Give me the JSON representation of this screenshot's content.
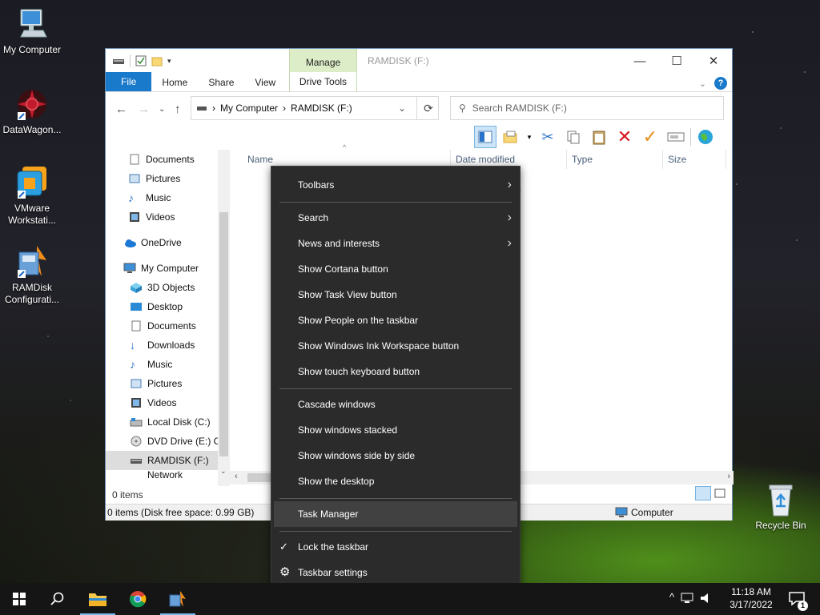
{
  "desktop": {
    "icons": [
      {
        "label": "My Computer",
        "icon": "computer-icon"
      },
      {
        "label": "DataWagon...",
        "icon": "datawagon-icon"
      },
      {
        "label": "VMware Workstati...",
        "icon": "vmware-icon"
      },
      {
        "label": "RAMDisk Configurati...",
        "icon": "ramdisk-icon"
      },
      {
        "label": "Recycle Bin",
        "icon": "recycle-bin-icon"
      }
    ]
  },
  "window": {
    "title": "RAMDISK (F:)",
    "context_group": "Manage",
    "tabs": {
      "file": "File",
      "home": "Home",
      "share": "Share",
      "view": "View",
      "drive_tools": "Drive Tools"
    },
    "address": {
      "crumbs": [
        "My Computer",
        "RAMDISK (F:)"
      ],
      "separator": "›"
    },
    "search_placeholder": "Search RAMDISK (F:)",
    "nav": {
      "quick": [
        "Documents",
        "Pictures",
        "Music",
        "Videos"
      ],
      "onedrive": "OneDrive",
      "pc": "My Computer",
      "pc_items": [
        "3D Objects",
        "Desktop",
        "Documents",
        "Downloads",
        "Music",
        "Pictures",
        "Videos",
        "Local Disk (C:)",
        "DVD Drive (E:) CI",
        "RAMDISK (F:)",
        "Network"
      ]
    },
    "columns": {
      "name": "Name",
      "date": "Date modified",
      "type": "Type",
      "size": "Size"
    },
    "empty_hint": "y.",
    "item_count": "0 items",
    "statusbar": {
      "left": "0 items (Disk free space: 0.99 GB)",
      "right": "Computer"
    },
    "controls": {
      "minimize": "—",
      "maximize": "☐",
      "close": "✕",
      "help": "?"
    }
  },
  "menu": {
    "toolbars": "Toolbars",
    "search": "Search",
    "news": "News and interests",
    "cortana": "Show Cortana button",
    "taskview": "Show Task View button",
    "people": "Show People on the taskbar",
    "ink": "Show Windows Ink Workspace button",
    "keyboard": "Show touch keyboard button",
    "cascade": "Cascade windows",
    "stacked": "Show windows stacked",
    "side": "Show windows side by side",
    "desktop": "Show the desktop",
    "taskmgr": "Task Manager",
    "lock": "Lock the taskbar",
    "settings": "Taskbar settings",
    "arrow": "›",
    "check": "✓",
    "gear": "⚙"
  },
  "taskbar": {
    "time": "11:18 AM",
    "date": "3/17/2022",
    "notif_count": "1"
  },
  "colors": {
    "accent": "#1979ca",
    "menu_bg": "#2b2b2b",
    "taskbar_bg": "#151515",
    "manage_bg": "#dcedc8"
  }
}
